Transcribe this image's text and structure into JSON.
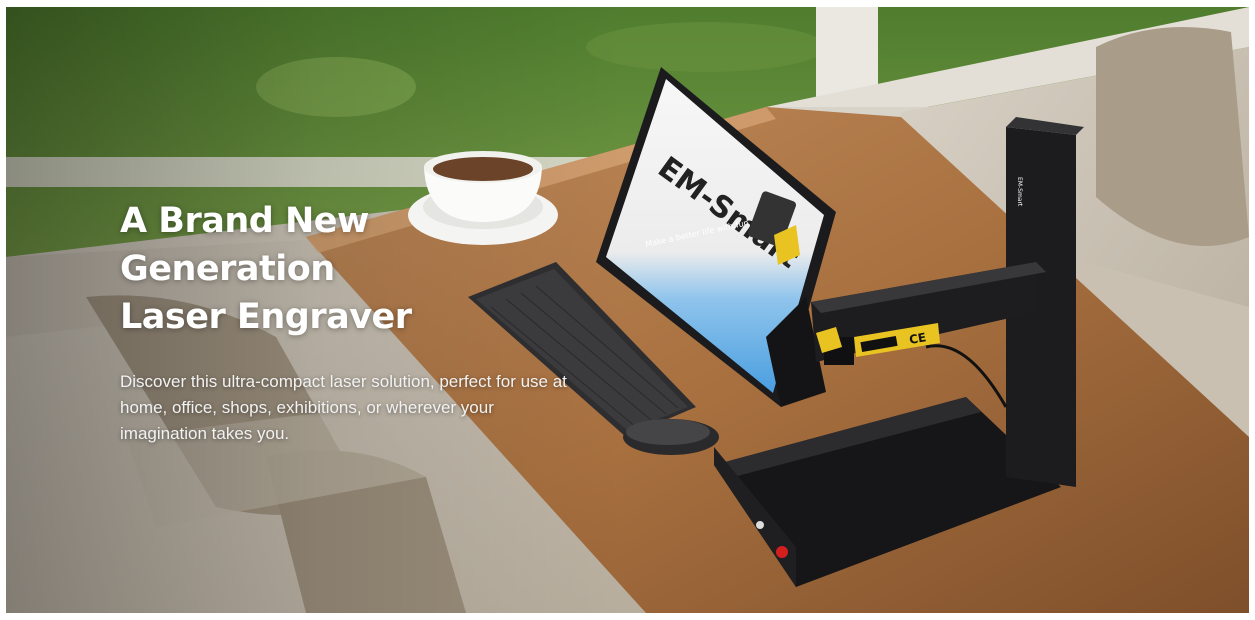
{
  "hero": {
    "headline_line1": "A Brand New Generation",
    "headline_line2": "Laser Engraver",
    "description": "Discover this ultra-compact laser solution, perfect for use at home, office, shops, exhibitions, or wherever your imagination takes you."
  },
  "product_image": {
    "screen_logo": "EM-Smart",
    "screen_tagline": "Make a better life with fun",
    "badge_ce": "CE"
  },
  "colors": {
    "machine": "#1c1c1e",
    "table": "#b07a4e",
    "grass": "#5e8a3a",
    "sofa": "#cfc6b8",
    "accent_yellow": "#e8c321",
    "power_button": "#d41f1f"
  }
}
